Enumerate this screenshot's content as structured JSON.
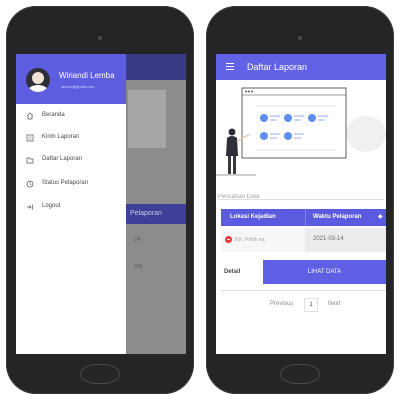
{
  "left_phone": {
    "background": {
      "bar_label": "Pelaporan",
      "text_line1": "-24",
      "text_line2": "ind"
    },
    "drawer": {
      "user_name": "Wiriandi Lemba",
      "user_email": "stvsvc@gmail.com",
      "items": [
        {
          "label": "Beranda",
          "icon": "home-icon"
        },
        {
          "label": "Kirim Laporan",
          "icon": "document-icon"
        },
        {
          "label": "Daftar Laporan",
          "icon": "folder-icon"
        },
        {
          "label": "Status Pelaporan",
          "icon": "status-icon"
        },
        {
          "label": "Logout",
          "icon": "logout-icon"
        }
      ]
    }
  },
  "right_phone": {
    "header": {
      "title": "Daftar Laporan"
    },
    "search": {
      "placeholder": "Pencarian Data"
    },
    "table": {
      "columns": [
        "Lokasi Kejadian",
        "Waktu Pelaporan"
      ],
      "rows": [
        {
          "lokasi": "Jl.K. Poltik no.",
          "waktu": "2021-03-14"
        }
      ]
    },
    "detail": {
      "label": "Detail",
      "button": "LIHAT DATA"
    },
    "pagination": {
      "previous": "Previous",
      "page": "1",
      "next": "Next"
    }
  },
  "colors": {
    "accent": "#6262e6",
    "header_dark": "#3f3f9a",
    "delete_red": "#e53935"
  }
}
